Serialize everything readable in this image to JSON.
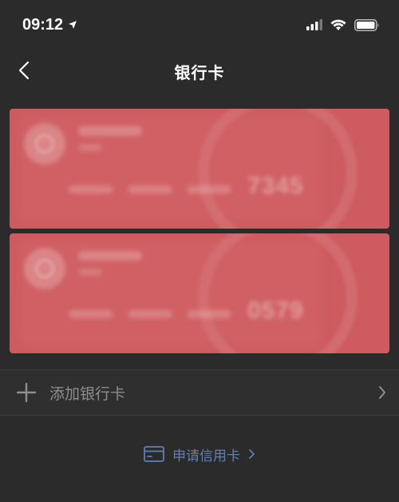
{
  "status": {
    "time": "09:12"
  },
  "nav": {
    "title": "银行卡"
  },
  "cards": [
    {
      "last4": "7345",
      "color": "#cd5b5f"
    },
    {
      "last4": "0579",
      "color": "#cd5b5f"
    }
  ],
  "add_card": {
    "label": "添加银行卡"
  },
  "apply_credit": {
    "label": "申请信用卡"
  },
  "colors": {
    "background": "#2b2b2b",
    "card": "#cd5b5f",
    "link": "#5f7fb3",
    "muted_text": "#8e8e8e"
  },
  "icons": {
    "location": "location-arrow-icon",
    "signal": "cellular-signal-icon",
    "wifi": "wifi-icon",
    "battery": "battery-icon",
    "back": "chevron-left-icon",
    "add": "plus-icon",
    "forward": "chevron-right-icon",
    "credit": "credit-card-icon"
  }
}
